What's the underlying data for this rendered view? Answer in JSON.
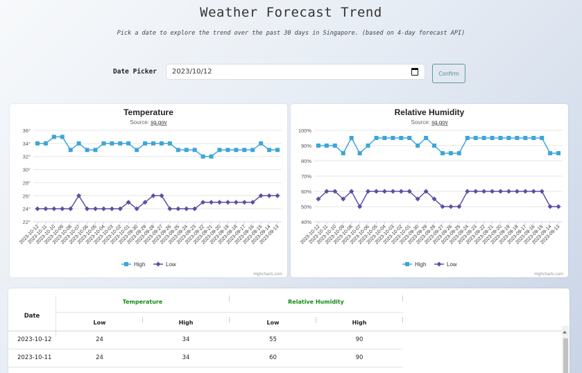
{
  "header": {
    "title": "Weather Forecast Trend",
    "subtitle": "Pick a date to explore the trend over the past 30 days in Singapore. (based on 4-day forecast API)"
  },
  "picker": {
    "label": "Date Picker",
    "value": "2023/10/12",
    "confirm_label": "Confirm"
  },
  "colors": {
    "high": "#3da5d9",
    "low": "#5b4fa5",
    "group_header": "#138a13"
  },
  "credit": "Highcharts.com",
  "chart_data": [
    {
      "type": "line",
      "title": "Temperature",
      "subtitle_prefix": "Source:",
      "subtitle_link": "sg.gov",
      "y_unit": "°",
      "ylim": [
        22,
        36
      ],
      "ytick_interval": 2,
      "categories": [
        "2023-10-12",
        "2023-10-11",
        "2023-10-10",
        "2023-10-09",
        "2023-10-08",
        "2023-10-07",
        "2023-10-06",
        "2023-10-05",
        "2023-10-04",
        "2023-10-03",
        "2023-10-02",
        "2023-10-01",
        "2023-09-30",
        "2023-09-29",
        "2023-09-28",
        "2023-09-27",
        "2023-09-26",
        "2023-09-25",
        "2023-09-24",
        "2023-09-23",
        "2023-09-22",
        "2023-09-21",
        "2023-09-20",
        "2023-09-19",
        "2023-09-18",
        "2023-09-17",
        "2023-09-16",
        "2023-09-15",
        "2023-09-14",
        "2023-09-13"
      ],
      "series": [
        {
          "name": "High",
          "values": [
            34,
            34,
            35,
            35,
            33,
            34,
            33,
            33,
            34,
            34,
            34,
            34,
            33,
            34,
            34,
            34,
            34,
            33,
            33,
            33,
            32,
            32,
            33,
            33,
            33,
            33,
            33,
            34,
            33,
            33
          ]
        },
        {
          "name": "Low",
          "values": [
            24,
            24,
            24,
            24,
            24,
            26,
            24,
            24,
            24,
            24,
            24,
            25,
            24,
            25,
            26,
            26,
            24,
            24,
            24,
            24,
            25,
            25,
            25,
            25,
            25,
            25,
            25,
            26,
            26,
            26
          ]
        }
      ],
      "legend": "bottom-center",
      "grid": true
    },
    {
      "type": "line",
      "title": "Relative Humidity",
      "subtitle_prefix": "Source:",
      "subtitle_link": "sg.gov",
      "y_unit": "%",
      "ylim": [
        40,
        100
      ],
      "ytick_interval": 10,
      "categories": [
        "2023-10-12",
        "2023-10-11",
        "2023-10-10",
        "2023-10-09",
        "2023-10-08",
        "2023-10-07",
        "2023-10-06",
        "2023-10-05",
        "2023-10-04",
        "2023-10-03",
        "2023-10-02",
        "2023-10-01",
        "2023-09-30",
        "2023-09-29",
        "2023-09-28",
        "2023-09-27",
        "2023-09-26",
        "2023-09-25",
        "2023-09-24",
        "2023-09-23",
        "2023-09-22",
        "2023-09-21",
        "2023-09-20",
        "2023-09-19",
        "2023-09-18",
        "2023-09-17",
        "2023-09-16",
        "2023-09-15",
        "2023-09-14",
        "2023-09-13"
      ],
      "series": [
        {
          "name": "High",
          "values": [
            90,
            90,
            90,
            85,
            95,
            85,
            90,
            95,
            95,
            95,
            95,
            95,
            90,
            95,
            90,
            85,
            85,
            85,
            95,
            95,
            95,
            95,
            95,
            95,
            95,
            95,
            95,
            95,
            85,
            85
          ]
        },
        {
          "name": "Low",
          "values": [
            55,
            60,
            60,
            55,
            60,
            50,
            60,
            60,
            60,
            60,
            60,
            60,
            55,
            60,
            55,
            50,
            50,
            50,
            60,
            60,
            60,
            60,
            60,
            60,
            60,
            60,
            60,
            60,
            50,
            50
          ]
        }
      ],
      "legend": "bottom-center",
      "grid": true
    }
  ],
  "table": {
    "date_header": "Date",
    "groups": [
      {
        "label": "Temperature",
        "low": "Low",
        "high": "High"
      },
      {
        "label": "Relative Humidity",
        "low": "Low",
        "high": "High"
      }
    ],
    "rows": [
      {
        "date": "2023-10-12",
        "temp_low": "24",
        "temp_high": "34",
        "rh_low": "55",
        "rh_high": "90"
      },
      {
        "date": "2023-10-11",
        "temp_low": "24",
        "temp_high": "34",
        "rh_low": "60",
        "rh_high": "90"
      }
    ]
  }
}
